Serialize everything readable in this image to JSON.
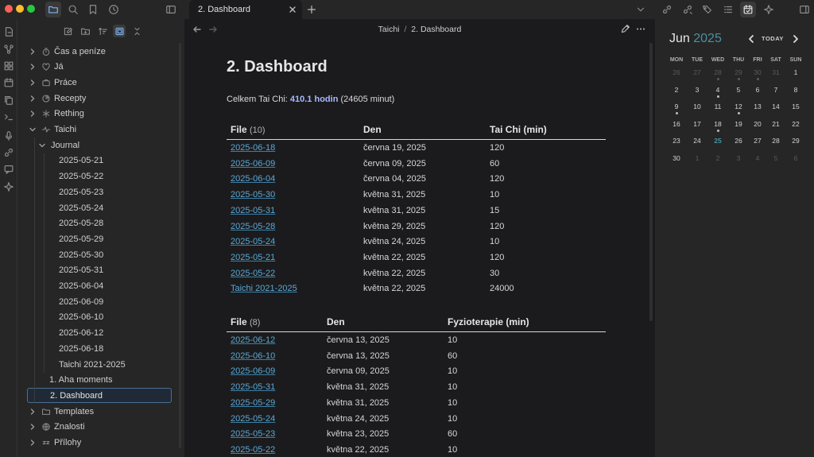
{
  "titlebar": {
    "tab_title": "2. Dashboard",
    "window_dots": [
      "#ff5f57",
      "#febc2e",
      "#28c840"
    ]
  },
  "editor": {
    "breadcrumb_folder": "Taichi",
    "breadcrumb_sep": "/",
    "breadcrumb_file": "2. Dashboard",
    "title": "2. Dashboard",
    "summary_prefix": "Celkem Tai Chi: ",
    "summary_bold": "410.1 hodin",
    "summary_suffix": " (24605 minut)"
  },
  "sidebar": {
    "items": [
      {
        "label": "Čas a peníze",
        "icon": "stopwatch-icon"
      },
      {
        "label": "Já",
        "icon": "heart-icon"
      },
      {
        "label": "Práce",
        "icon": "briefcase-icon"
      },
      {
        "label": "Recepty",
        "icon": "pie-icon"
      },
      {
        "label": "Rething",
        "icon": "asterisk-icon"
      },
      {
        "label": "Taichi",
        "icon": "activity-icon"
      },
      {
        "label": "Journal"
      },
      {
        "label": "2025-05-21"
      },
      {
        "label": "2025-05-22"
      },
      {
        "label": "2025-05-23"
      },
      {
        "label": "2025-05-24"
      },
      {
        "label": "2025-05-28"
      },
      {
        "label": "2025-05-29"
      },
      {
        "label": "2025-05-30"
      },
      {
        "label": "2025-05-31"
      },
      {
        "label": "2025-06-04"
      },
      {
        "label": "2025-06-09"
      },
      {
        "label": "2025-06-10"
      },
      {
        "label": "2025-06-12"
      },
      {
        "label": "2025-06-18"
      },
      {
        "label": "Taichi 2021-2025"
      },
      {
        "label": "1. Aha moments"
      },
      {
        "label": "2. Dashboard"
      },
      {
        "label": "Templates",
        "icon": "folder-icon"
      },
      {
        "label": "Znalosti",
        "icon": "globe-icon"
      },
      {
        "label": "Přílohy",
        "icon": "zz-icon"
      }
    ]
  },
  "table1": {
    "headers": [
      "File",
      "(10)",
      "Den",
      "Tai Chi (min)"
    ],
    "rows": [
      [
        "2025-06-18",
        "června 19, 2025",
        "120"
      ],
      [
        "2025-06-09",
        "června 09, 2025",
        "60"
      ],
      [
        "2025-06-04",
        "června 04, 2025",
        "120"
      ],
      [
        "2025-05-30",
        "května 31, 2025",
        "10"
      ],
      [
        "2025-05-31",
        "května 31, 2025",
        "15"
      ],
      [
        "2025-05-28",
        "května 29, 2025",
        "120"
      ],
      [
        "2025-05-24",
        "května 24, 2025",
        "10"
      ],
      [
        "2025-05-21",
        "května 22, 2025",
        "120"
      ],
      [
        "2025-05-22",
        "května 22, 2025",
        "30"
      ],
      [
        "Taichi 2021-2025",
        "května 22, 2025",
        "24000"
      ]
    ]
  },
  "table2": {
    "headers": [
      "File",
      "(8)",
      "Den",
      "Fyzioterapie (min)"
    ],
    "rows": [
      [
        "2025-06-12",
        "června 13, 2025",
        "10"
      ],
      [
        "2025-06-10",
        "června 13, 2025",
        "60"
      ],
      [
        "2025-06-09",
        "června 09, 2025",
        "10"
      ],
      [
        "2025-05-31",
        "května 31, 2025",
        "10"
      ],
      [
        "2025-05-29",
        "května 31, 2025",
        "10"
      ],
      [
        "2025-05-24",
        "května 24, 2025",
        "10"
      ],
      [
        "2025-05-23",
        "května 23, 2025",
        "60"
      ],
      [
        "2025-05-22",
        "května 22, 2025",
        "10"
      ]
    ]
  },
  "calendar": {
    "month": "Jun",
    "year": "2025",
    "today_label": "TODAY",
    "dow": [
      "MON",
      "TUE",
      "WED",
      "THU",
      "FRI",
      "SAT",
      "SUN"
    ],
    "weeks": [
      [
        "26",
        "27",
        "28",
        "29",
        "30",
        "31",
        "1"
      ],
      [
        "2",
        "3",
        "4",
        "5",
        "6",
        "7",
        "8"
      ],
      [
        "9",
        "10",
        "11",
        "12",
        "13",
        "14",
        "15"
      ],
      [
        "16",
        "17",
        "18",
        "19",
        "20",
        "21",
        "22"
      ],
      [
        "23",
        "24",
        "25",
        "26",
        "27",
        "28",
        "29"
      ],
      [
        "30",
        "1",
        "2",
        "3",
        "4",
        "5",
        "6"
      ]
    ],
    "today": "25",
    "accent": "#4a90a4"
  }
}
